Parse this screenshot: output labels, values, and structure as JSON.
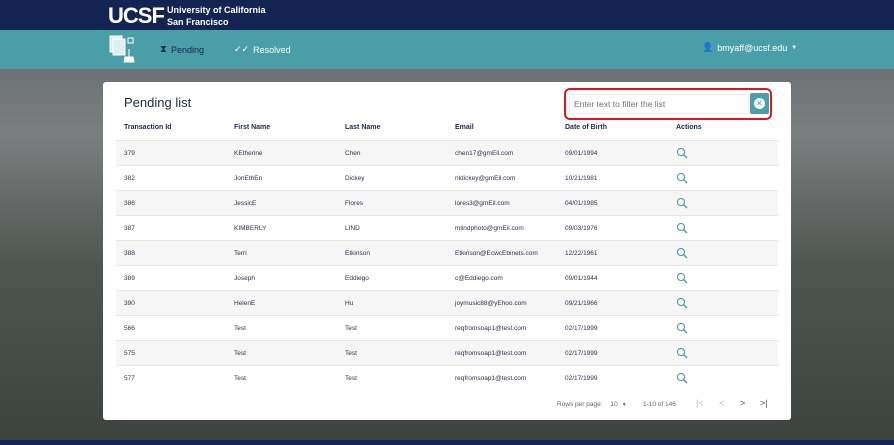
{
  "header": {
    "logo": "UCSF",
    "university_line1": "University of California",
    "university_line2": "San Francisco"
  },
  "nav": {
    "items": [
      {
        "label": "Pending",
        "icon": "hourglass-icon"
      },
      {
        "label": "Resolved",
        "icon": "double-check-icon"
      }
    ],
    "user": "bmyaff@ucsf.edu"
  },
  "card": {
    "title": "Pending list",
    "filter": {
      "placeholder": "Enter text to filter the list",
      "value": ""
    }
  },
  "table": {
    "columns": [
      "Transaction Id",
      "First Name",
      "Last Name",
      "Email",
      "Date of Birth",
      "Actions"
    ],
    "rows": [
      [
        "379",
        "KEtherine",
        "Chen",
        "chen17@gmEil.com",
        "09/01/1994"
      ],
      [
        "382",
        "JonEthEn",
        "Dickey",
        "nldickey@gmEil.com",
        "10/21/1981"
      ],
      [
        "386",
        "JessicE",
        "Flores",
        "lores3@gmEil.com",
        "04/01/1985"
      ],
      [
        "387",
        "KIMBERLY",
        "LIND",
        "mlindphoto@gmEil.com",
        "09/03/1976"
      ],
      [
        "388",
        "Terri",
        "Etkinson",
        "Etkinson@EcwcEbinets.com",
        "12/22/1961"
      ],
      [
        "389",
        "Joseph",
        "Eddiego",
        "c@Eddiego.com",
        "09/01/1944"
      ],
      [
        "390",
        "HelenE",
        "Hu",
        "joymusic88@yEhoo.com",
        "09/21/1966"
      ],
      [
        "566",
        "Test",
        "Test",
        "reqfromsoap1@test.com",
        "02/17/1999"
      ],
      [
        "575",
        "Test",
        "Test",
        "reqfromsoap1@test.com",
        "02/17/1999"
      ],
      [
        "577",
        "Test",
        "Test",
        "reqfromsoap1@test.com",
        "02/17/1999"
      ]
    ]
  },
  "pagination": {
    "rows_per_page_label": "Rows per page:",
    "rows_per_page": "10",
    "range": "1-10 of 146"
  },
  "colors": {
    "navy": "#142452",
    "teal": "#4a9ea8",
    "highlight": "#e0141e"
  }
}
